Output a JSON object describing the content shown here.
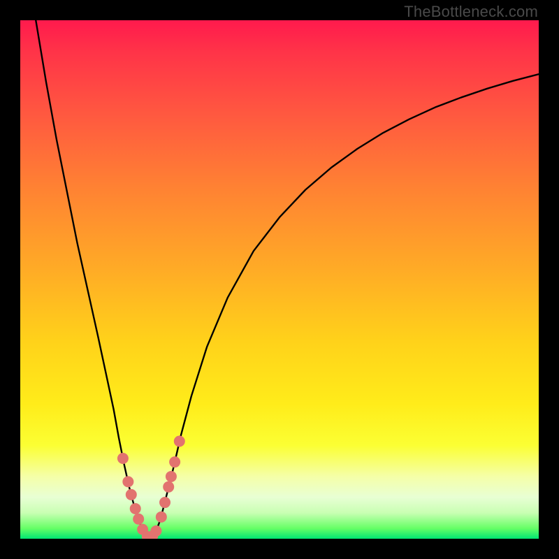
{
  "attribution": "TheBottleneck.com",
  "chart_data": {
    "type": "line",
    "title": "",
    "xlabel": "",
    "ylabel": "",
    "xlim": [
      0,
      100
    ],
    "ylim": [
      0,
      100
    ],
    "grid": false,
    "legend": false,
    "background_gradient": {
      "orientation": "vertical",
      "stops": [
        {
          "pos": 0.0,
          "color": "#ff1a4d"
        },
        {
          "pos": 0.06,
          "color": "#ff3348"
        },
        {
          "pos": 0.18,
          "color": "#ff5840"
        },
        {
          "pos": 0.32,
          "color": "#ff8133"
        },
        {
          "pos": 0.48,
          "color": "#ffab26"
        },
        {
          "pos": 0.62,
          "color": "#ffd21a"
        },
        {
          "pos": 0.74,
          "color": "#ffec1a"
        },
        {
          "pos": 0.82,
          "color": "#fbff33"
        },
        {
          "pos": 0.88,
          "color": "#f5ffa8"
        },
        {
          "pos": 0.92,
          "color": "#e8ffd4"
        },
        {
          "pos": 0.95,
          "color": "#c9ffb3"
        },
        {
          "pos": 0.98,
          "color": "#66ff66"
        },
        {
          "pos": 1.0,
          "color": "#00e673"
        }
      ]
    },
    "series": [
      {
        "name": "bottleneck-curve",
        "color": "#000000",
        "x": [
          3.0,
          5.0,
          7.0,
          9.0,
          11.0,
          13.0,
          15.0,
          16.5,
          18.0,
          19.0,
          20.0,
          21.0,
          22.0,
          23.0,
          23.8,
          24.5,
          25.0,
          26.0,
          27.0,
          28.0,
          29.5,
          31.0,
          33.0,
          36.0,
          40.0,
          45.0,
          50.0,
          55.0,
          60.0,
          65.0,
          70.0,
          75.0,
          80.0,
          85.0,
          90.0,
          95.0,
          100.0
        ],
        "y": [
          100.0,
          88.0,
          77.0,
          67.0,
          57.0,
          48.0,
          39.0,
          32.0,
          25.0,
          19.5,
          14.5,
          10.0,
          6.2,
          3.2,
          1.3,
          0.3,
          0.0,
          1.0,
          3.6,
          7.5,
          13.5,
          20.0,
          27.5,
          37.0,
          46.5,
          55.5,
          62.0,
          67.3,
          71.6,
          75.2,
          78.3,
          80.9,
          83.2,
          85.1,
          86.8,
          88.3,
          89.6
        ]
      }
    ],
    "markers": [
      {
        "name": "highlight-points",
        "color": "#e2736f",
        "radius": 8,
        "points": [
          {
            "x": 19.8,
            "y": 15.5
          },
          {
            "x": 20.8,
            "y": 11.0
          },
          {
            "x": 21.4,
            "y": 8.5
          },
          {
            "x": 22.2,
            "y": 5.8
          },
          {
            "x": 22.8,
            "y": 3.8
          },
          {
            "x": 23.6,
            "y": 1.8
          },
          {
            "x": 24.5,
            "y": 0.4
          },
          {
            "x": 25.5,
            "y": 0.5
          },
          {
            "x": 26.2,
            "y": 1.5
          },
          {
            "x": 27.2,
            "y": 4.2
          },
          {
            "x": 27.9,
            "y": 7.0
          },
          {
            "x": 28.6,
            "y": 10.0
          },
          {
            "x": 29.1,
            "y": 12.0
          },
          {
            "x": 29.8,
            "y": 14.8
          },
          {
            "x": 30.7,
            "y": 18.8
          }
        ]
      }
    ]
  }
}
